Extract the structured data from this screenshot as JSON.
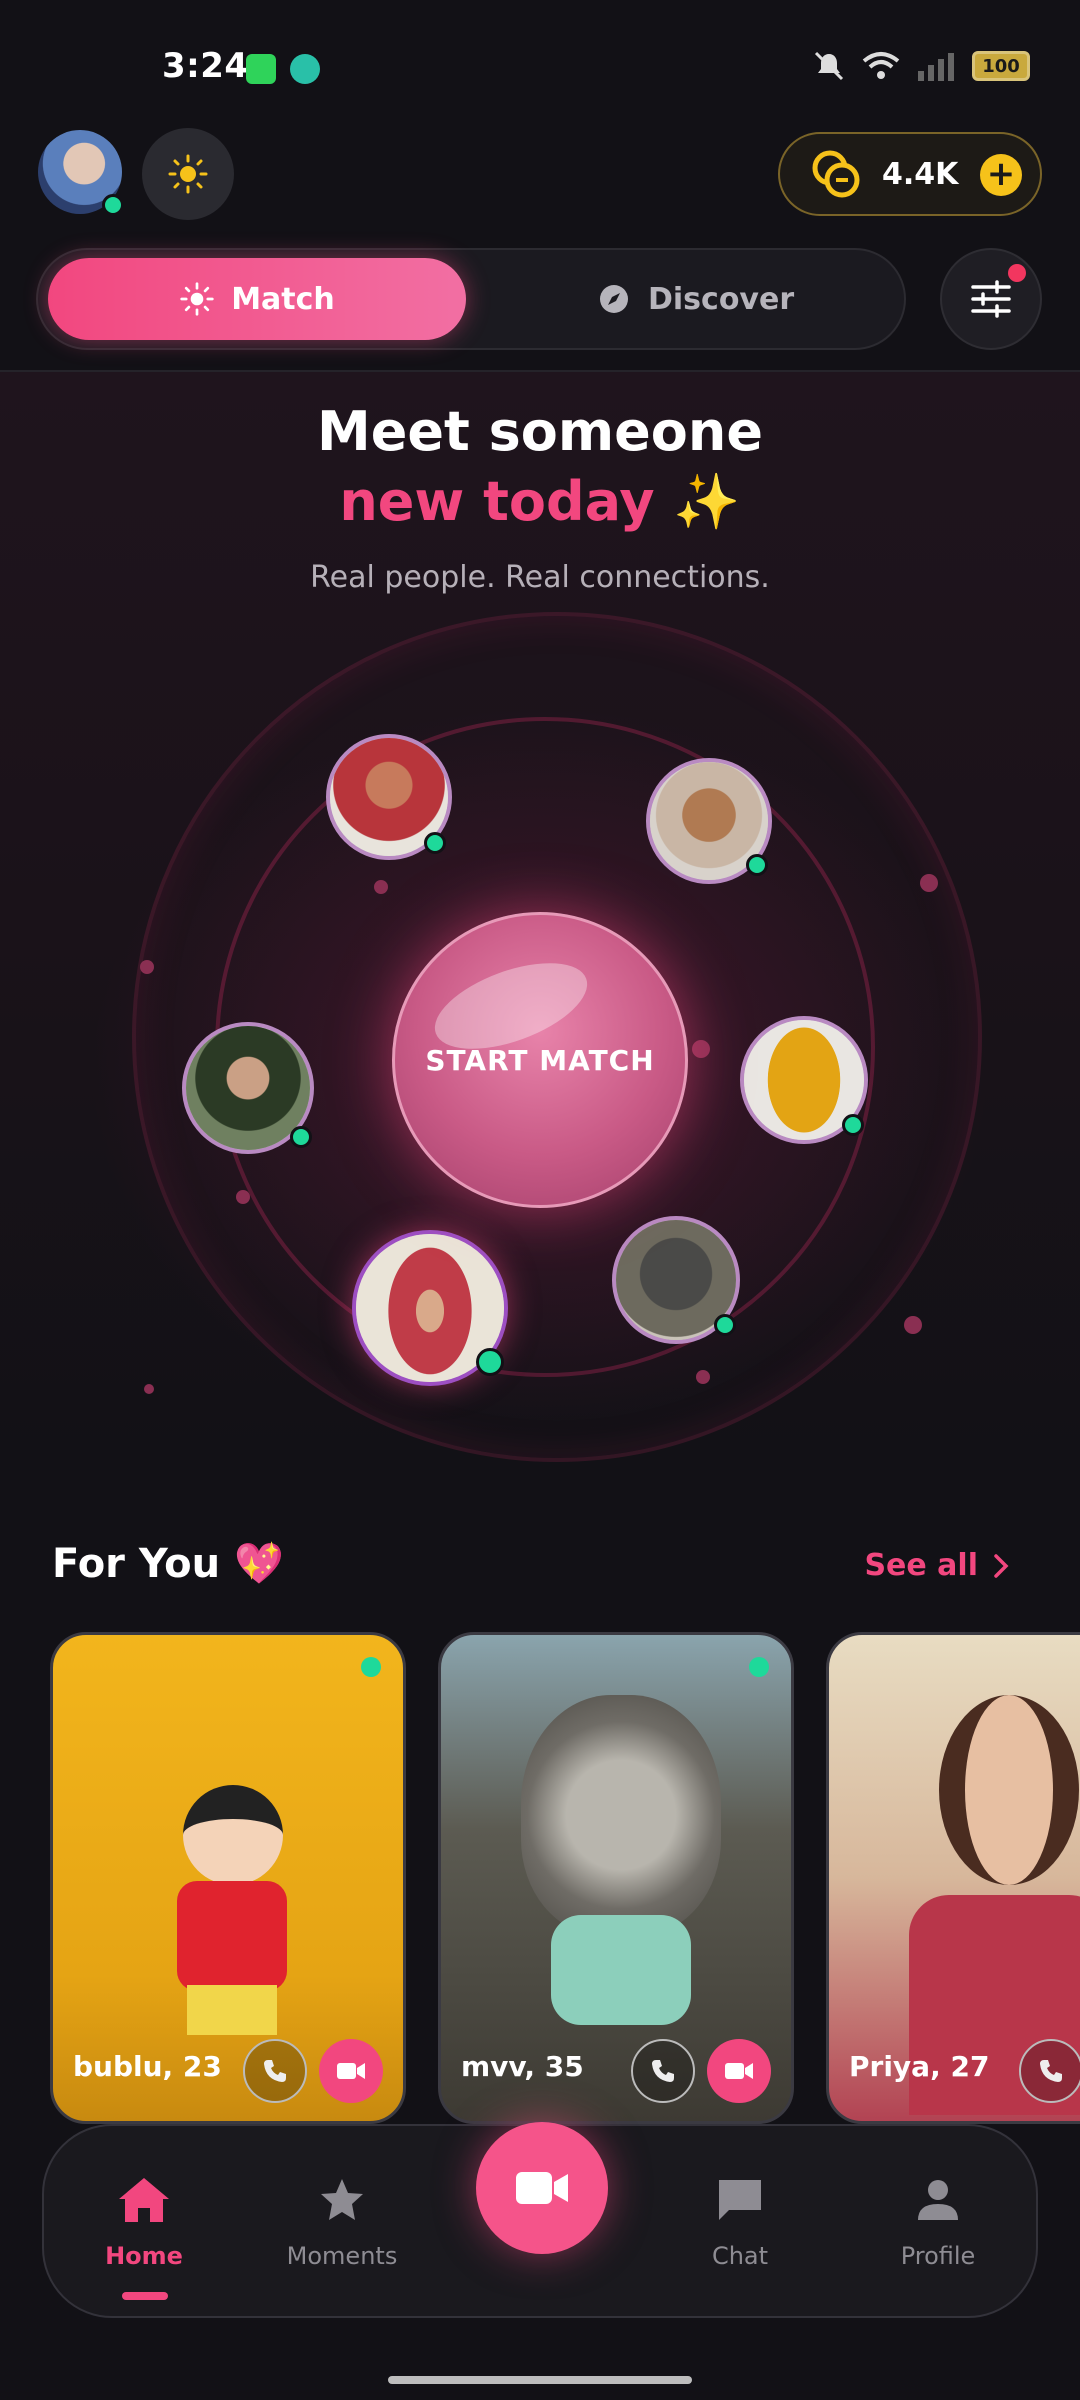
{
  "status_bar": {
    "time": "3:24",
    "battery": "100"
  },
  "header": {
    "coins": "4.4K",
    "coins_plus": "+"
  },
  "segment": {
    "match_label": "Match",
    "discover_label": "Discover"
  },
  "hero": {
    "title_line1": "Meet someone",
    "title_line2": "new today ✨",
    "subtitle": "Real people. Real connections.",
    "start_button": "START MATCH"
  },
  "for_you": {
    "title": "For You 💖",
    "see_all": "See all"
  },
  "cards": [
    {
      "name": "bublu, 23",
      "bg": "#efb21a"
    },
    {
      "name": "mvv, 35",
      "bg": "#6b6d66"
    },
    {
      "name": "Priya, 27",
      "bg": "#d9c6b2"
    }
  ],
  "nav": {
    "home": "Home",
    "moments": "Moments",
    "chat": "Chat",
    "profile": "Profile"
  },
  "colors": {
    "accent": "#f2477f",
    "online": "#1ed99a",
    "coin": "#f6c21a"
  }
}
